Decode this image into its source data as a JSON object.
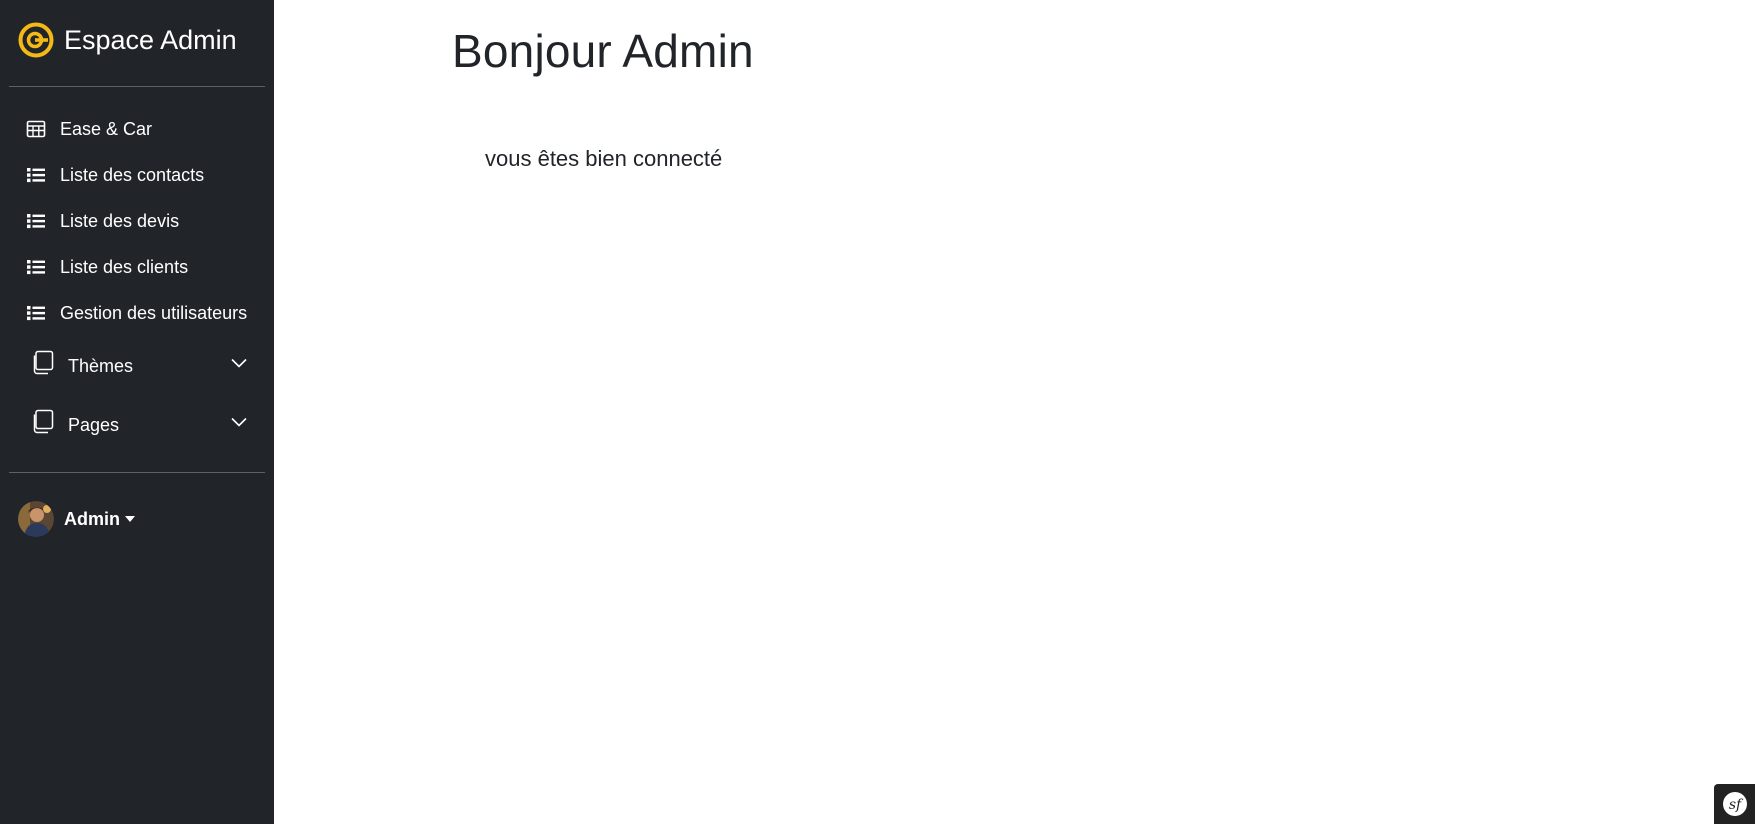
{
  "brand": {
    "title": "Espace Admin",
    "icon": "brand-logo-icon",
    "color": "#f5b915"
  },
  "sidebar": {
    "background": "#212529",
    "items": [
      {
        "label": "Ease & Car",
        "icon": "table-icon"
      },
      {
        "label": "Liste des contacts",
        "icon": "list-icon"
      },
      {
        "label": "Liste des devis",
        "icon": "list-icon"
      },
      {
        "label": "Liste des clients",
        "icon": "list-icon"
      },
      {
        "label": "Gestion des utilisateurs",
        "icon": "list-icon"
      }
    ],
    "groups": [
      {
        "label": "Thèmes",
        "icon": "pages-icon",
        "expand_icon": "chevron-down-icon"
      },
      {
        "label": "Pages",
        "icon": "pages-icon",
        "expand_icon": "chevron-down-icon"
      }
    ]
  },
  "user": {
    "name": "Admin",
    "avatar": "avatar",
    "dropdown_icon": "caret-down-icon"
  },
  "main": {
    "title": "Bonjour Admin",
    "message": "vous êtes bien connecté"
  },
  "debug_toolbar": {
    "icon": "symfony-logo-icon"
  }
}
